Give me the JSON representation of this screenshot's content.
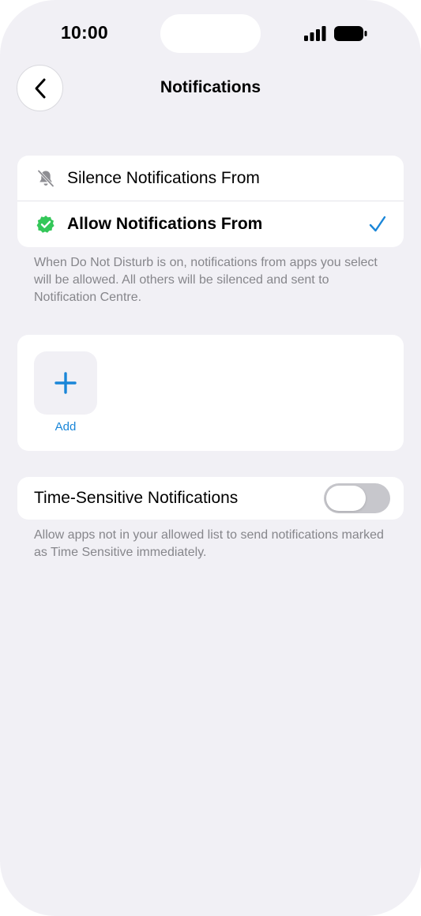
{
  "status_bar": {
    "time": "10:00"
  },
  "nav": {
    "title": "Notifications",
    "back_icon": "chevron-left-icon"
  },
  "mode": {
    "options": [
      {
        "label": "Silence Notifications From",
        "icon": "bell-slash-icon",
        "selected": false
      },
      {
        "label": "Allow Notifications From",
        "icon": "verified-badge-icon",
        "selected": true
      }
    ],
    "footnote": "When Do Not Disturb is on, notifications from apps you select will be allowed. All others will be silenced and sent to Notification Centre."
  },
  "apps": {
    "add_label": "Add"
  },
  "time_sensitive": {
    "label": "Time-Sensitive Notifications",
    "enabled": false,
    "footnote": "Allow apps not in your allowed list to send notifications marked as Time Sensitive immediately."
  },
  "colors": {
    "accent": "#1a86d8",
    "badge_green": "#34c759",
    "background": "#f1f0f5"
  }
}
